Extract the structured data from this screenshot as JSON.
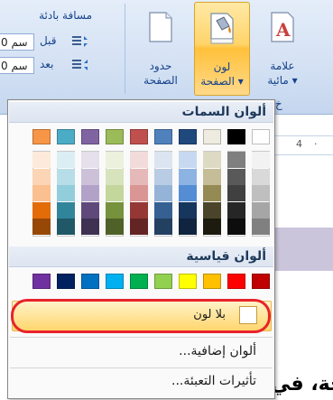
{
  "ribbon": {
    "paragraph_group_label": "مسافة بادئة",
    "spacing_before_label": "قبل",
    "spacing_after_label": "بعد",
    "spacing_before_value": "0 سم",
    "spacing_after_value": "0 سم",
    "page_borders": {
      "line1": "حدود",
      "line2": "الصفحة"
    },
    "page_color": {
      "line1": "لون",
      "line2": "الصفحة ▾"
    },
    "watermark": {
      "line1": "علامة",
      "line2": "مائية ▾"
    },
    "collapsed_label": "خ"
  },
  "doc": {
    "ruler_marks": [
      "4",
      "·"
    ],
    "bottom_text": "حة، في"
  },
  "dropdown": {
    "theme_header": "ألوان السمات",
    "standard_header": "ألوان قياسية",
    "no_color_label": "بلا لون",
    "more_colors_label": "ألوان إضافية...",
    "fill_effects_label": "تأثيرات التعبئة...",
    "theme_colors": [
      {
        "base": "#ffffff",
        "shades": [
          "#f2f2f2",
          "#d9d9d9",
          "#bfbfbf",
          "#a6a6a6",
          "#808080"
        ]
      },
      {
        "base": "#000000",
        "shades": [
          "#7f7f7f",
          "#595959",
          "#404040",
          "#262626",
          "#0d0d0d"
        ]
      },
      {
        "base": "#eeece1",
        "shades": [
          "#ddd9c3",
          "#c4bd97",
          "#948a54",
          "#4a452a",
          "#1d1b10"
        ]
      },
      {
        "base": "#1f497d",
        "shades": [
          "#c6d9f0",
          "#8db3e2",
          "#548dd4",
          "#17365d",
          "#0f243e"
        ]
      },
      {
        "base": "#4f81bd",
        "shades": [
          "#dbe5f1",
          "#b8cce4",
          "#95b3d7",
          "#366092",
          "#244061"
        ]
      },
      {
        "base": "#c0504d",
        "shades": [
          "#f2dcdb",
          "#e5b9b7",
          "#d99694",
          "#953734",
          "#632423"
        ]
      },
      {
        "base": "#9bbb59",
        "shades": [
          "#ebf1dd",
          "#d7e3bc",
          "#c3d69b",
          "#76923c",
          "#4f6128"
        ]
      },
      {
        "base": "#8064a2",
        "shades": [
          "#e5e0ec",
          "#ccc1d9",
          "#b2a2c7",
          "#5f497a",
          "#3f3151"
        ]
      },
      {
        "base": "#4bacc6",
        "shades": [
          "#dbeef3",
          "#b7dde8",
          "#92cddc",
          "#31859b",
          "#205867"
        ]
      },
      {
        "base": "#f79646",
        "shades": [
          "#fdeada",
          "#fbd5b5",
          "#fac08f",
          "#e36c09",
          "#974806"
        ]
      }
    ],
    "standard_colors": [
      "#c00000",
      "#ff0000",
      "#ffc000",
      "#ffff00",
      "#92d050",
      "#00b050",
      "#00b0f0",
      "#0070c0",
      "#002060",
      "#7030a0"
    ]
  }
}
